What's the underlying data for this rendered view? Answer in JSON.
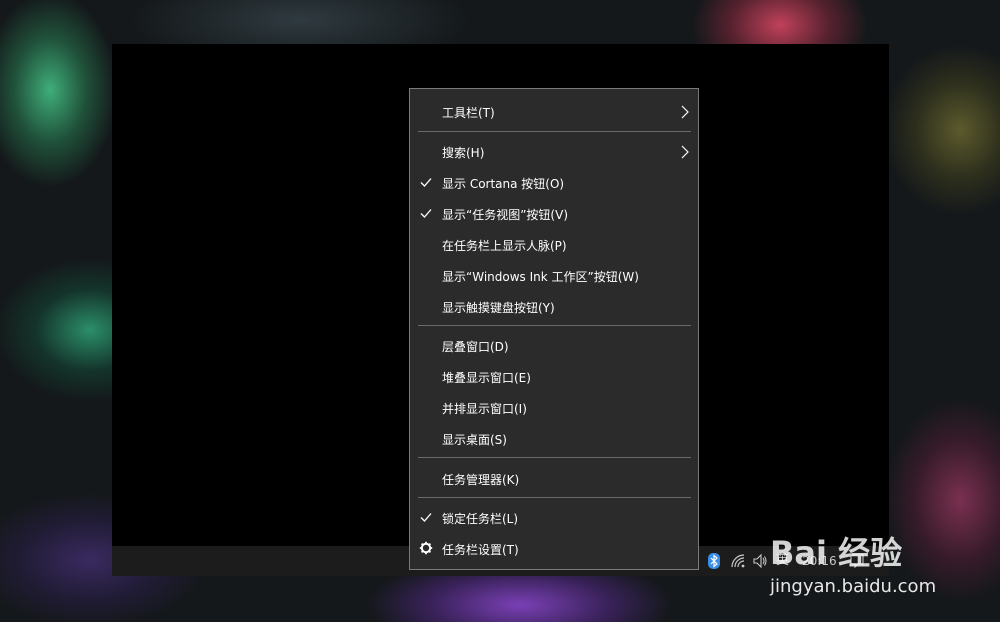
{
  "context_menu": {
    "items": [
      {
        "label": "工具栏(T)",
        "checked": false,
        "submenu": true
      },
      {
        "label": "搜索(H)",
        "checked": false,
        "submenu": true
      },
      {
        "label": "显示 Cortana 按钮(O)",
        "checked": true,
        "submenu": false
      },
      {
        "label": "显示“任务视图”按钮(V)",
        "checked": true,
        "submenu": false
      },
      {
        "label": "在任务栏上显示人脉(P)",
        "checked": false,
        "submenu": false
      },
      {
        "label": "显示“Windows Ink 工作区”按钮(W)",
        "checked": false,
        "submenu": false
      },
      {
        "label": "显示触摸键盘按钮(Y)",
        "checked": false,
        "submenu": false
      },
      {
        "label": "层叠窗口(D)",
        "checked": false,
        "submenu": false
      },
      {
        "label": "堆叠显示窗口(E)",
        "checked": false,
        "submenu": false
      },
      {
        "label": "并排显示窗口(I)",
        "checked": false,
        "submenu": false
      },
      {
        "label": "显示桌面(S)",
        "checked": false,
        "submenu": false
      },
      {
        "label": "任务管理器(K)",
        "checked": false,
        "submenu": false
      },
      {
        "label": "锁定任务栏(L)",
        "checked": true,
        "submenu": false
      },
      {
        "label": "任务栏设置(T)",
        "checked": false,
        "submenu": false,
        "icon": "gear-icon"
      }
    ]
  },
  "taskbar": {
    "ime": "英",
    "clock": "20:16",
    "tray_icons": [
      "bluetooth-icon",
      "network-icon",
      "volume-icon",
      "notification-icon"
    ]
  },
  "watermark": {
    "brand": "Bai 经验",
    "url": "jingyan.baidu.com"
  },
  "colors": {
    "menu_bg": "#2b2b2b",
    "menu_border": "#7a7a7a",
    "menu_text": "#ffffff",
    "separator": "#6a6a6a",
    "taskbar_bg": "#1c1c1c",
    "bluetooth": "#3a8ee6"
  }
}
